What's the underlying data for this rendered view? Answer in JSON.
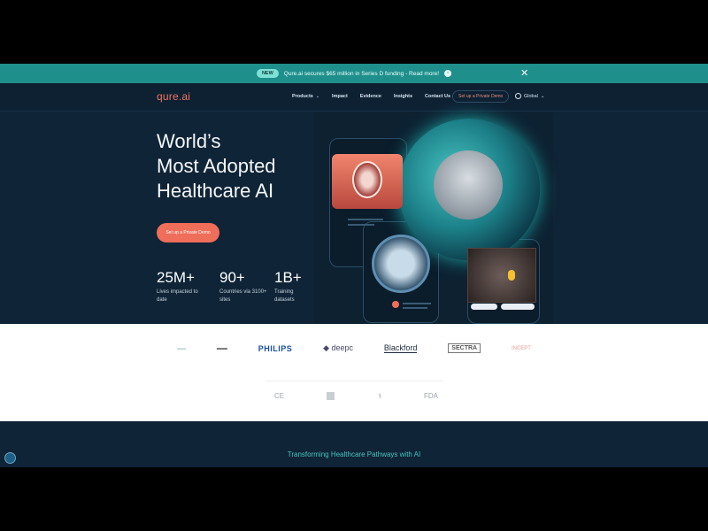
{
  "announcement": {
    "pill": "NEW",
    "message": "Qure.ai secures $65 million in Series D funding - Read more!",
    "color": "#1f8f8c"
  },
  "nav": {
    "logo": "qure.ai",
    "links": [
      {
        "label": "Products",
        "has_dropdown": true
      },
      {
        "label": "Impact"
      },
      {
        "label": "Evidence"
      },
      {
        "label": "Insights"
      },
      {
        "label": "Contact Us"
      }
    ],
    "demo_button": "Set up a Private Demo",
    "region": "Global"
  },
  "hero": {
    "title_lines": [
      "World’s",
      "Most Adopted",
      "Healthcare AI"
    ],
    "cta": "Set up a Private Demo",
    "stats": [
      {
        "value": "25M+",
        "label": "Lives impacted to date"
      },
      {
        "value": "90+",
        "label": "Countries via 3100+ sites"
      },
      {
        "value": "1B+",
        "label": "Training datasets"
      }
    ],
    "accent_color": "#ee6e5a"
  },
  "partners": {
    "logos": [
      "",
      "",
      "PHILIPS",
      "deepc",
      "Blackford",
      "SECTRA",
      "INCEPT"
    ],
    "certifications": [
      "CE",
      "",
      "",
      "FDA"
    ]
  },
  "footer": {
    "tagline": "Transforming Healthcare Pathways with AI",
    "tagline_color": "#47c4c2"
  }
}
